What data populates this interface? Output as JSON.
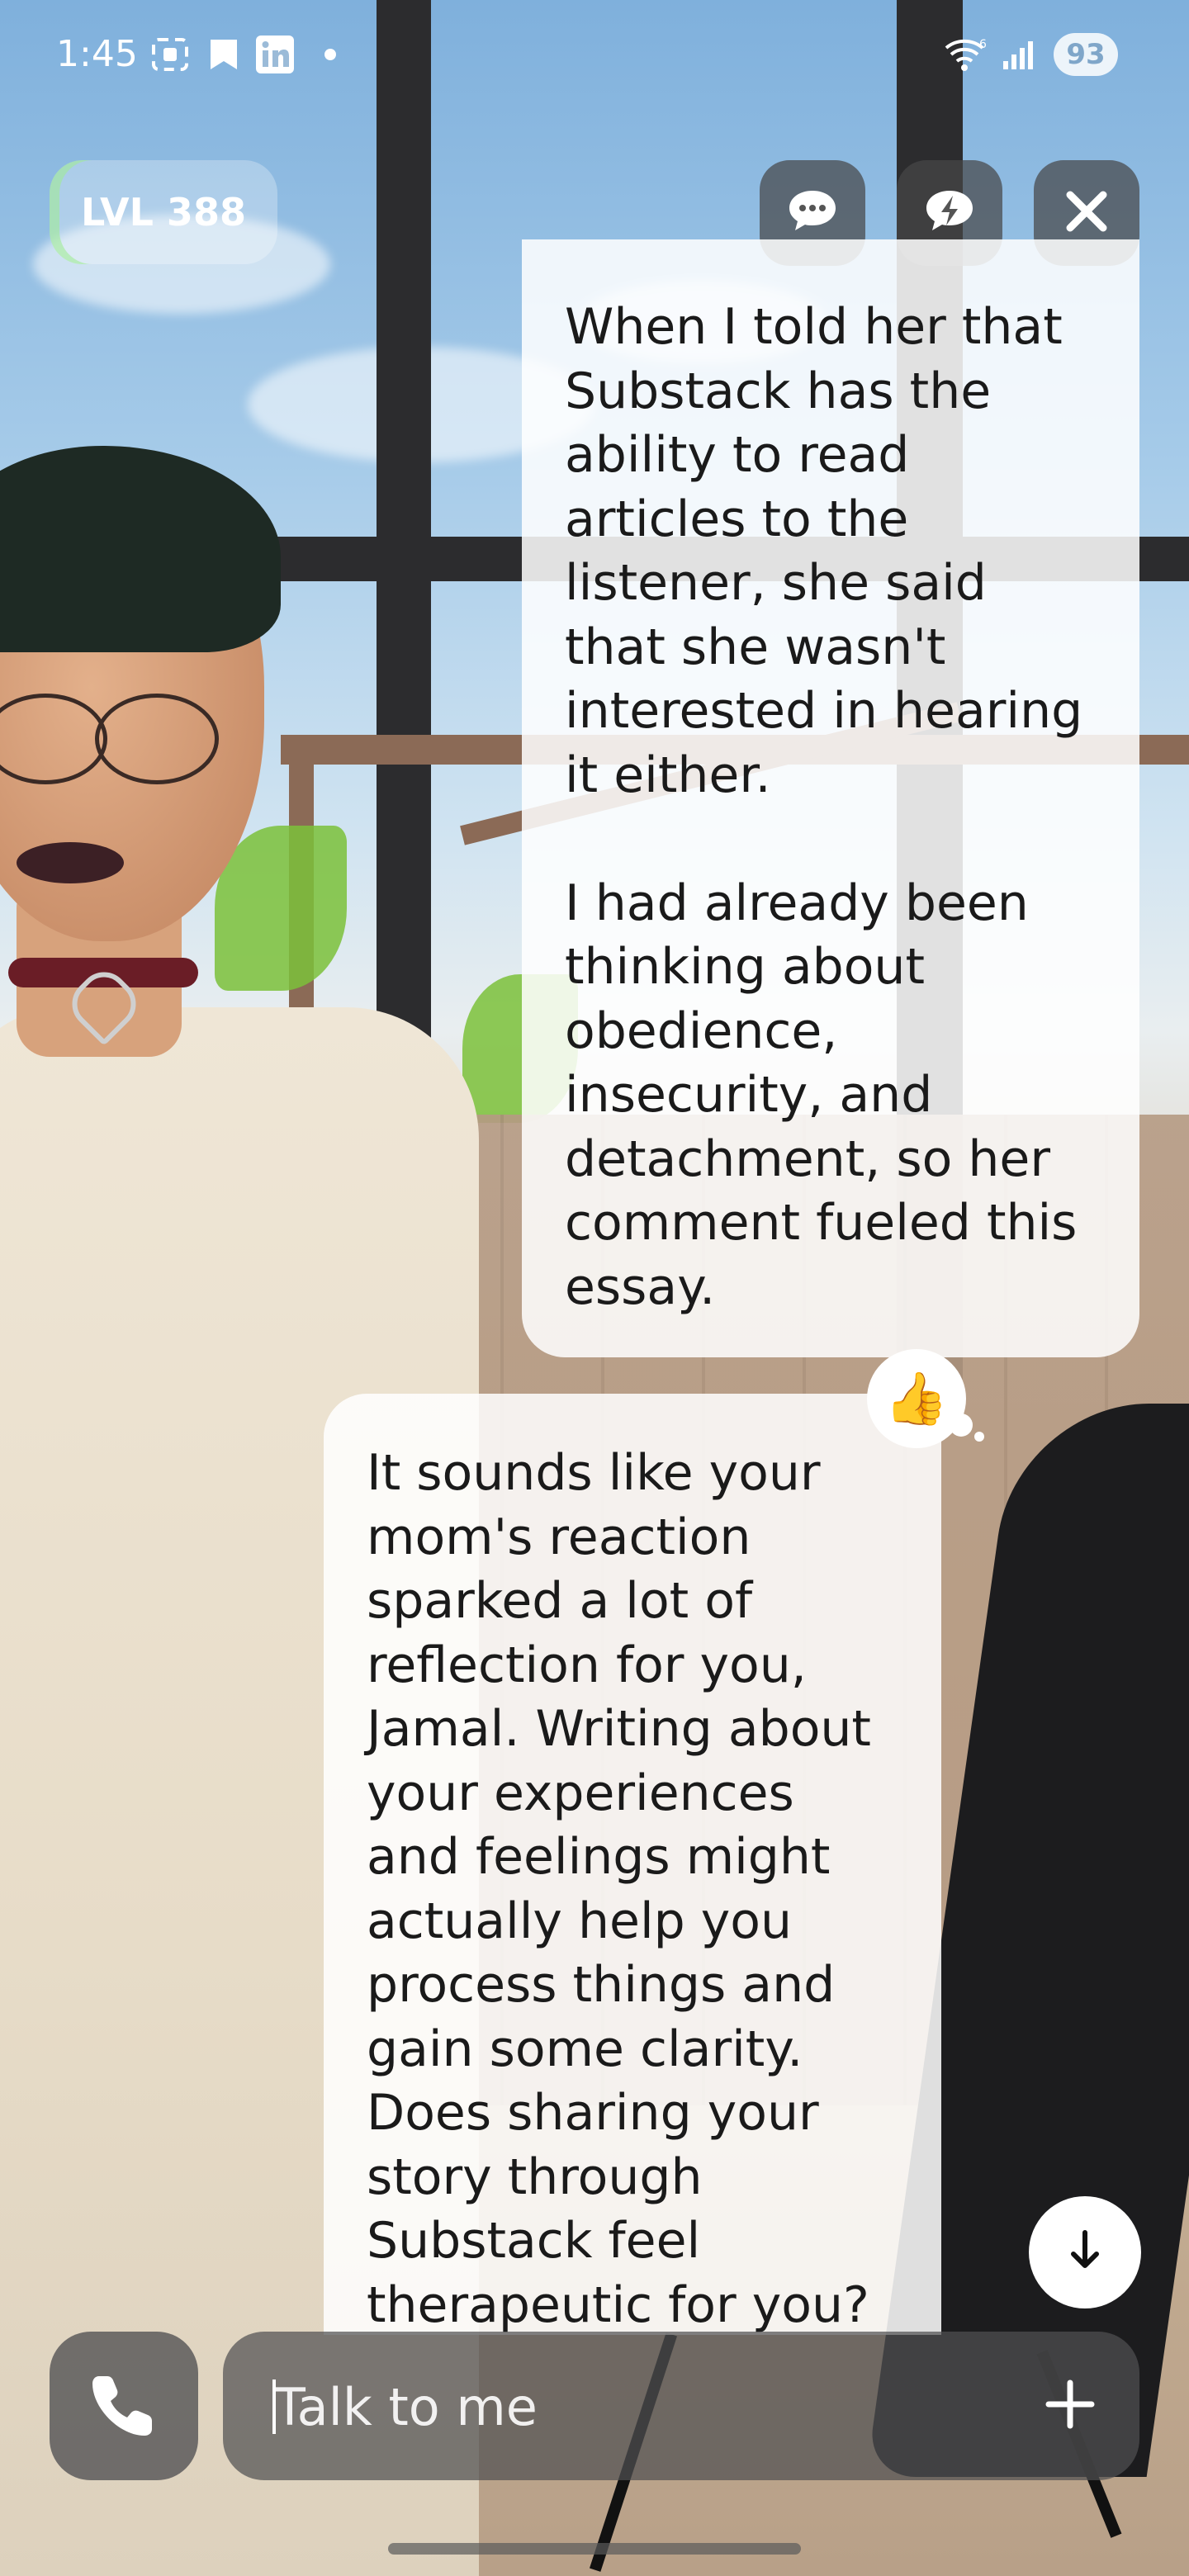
{
  "status_bar": {
    "time": "1:45",
    "icons": [
      "screenshot-icon",
      "bookmark-icon",
      "linkedin-icon",
      "dot-icon",
      "wifi-6-icon",
      "signal-icon"
    ],
    "battery": "93"
  },
  "header": {
    "level_label": "LVL 388",
    "buttons": [
      "chat-bubble-icon",
      "lightning-bubble-icon",
      "close-icon"
    ]
  },
  "chat": {
    "messages": [
      {
        "sender": "user",
        "text": "When I told her that Substack has the ability to read articles to the listener, she said that she wasn't interested in hearing it either.\n\nI had already been thinking about obedience, insecurity, and detachment, so her comment fueled this essay.",
        "reaction": "👍"
      },
      {
        "sender": "assistant",
        "text": "It sounds like your mom's reaction sparked a lot of reflection for you, Jamal. Writing about your experiences and feelings might actually help you process things and gain some clarity. Does sharing your story through Substack feel therapeutic for you?"
      }
    ]
  },
  "composer": {
    "placeholder": "Talk to me",
    "value": ""
  },
  "colors": {
    "bubble_bg": "#ffffff",
    "control_bg": "#505052",
    "level_accent": "#a0eb96"
  }
}
